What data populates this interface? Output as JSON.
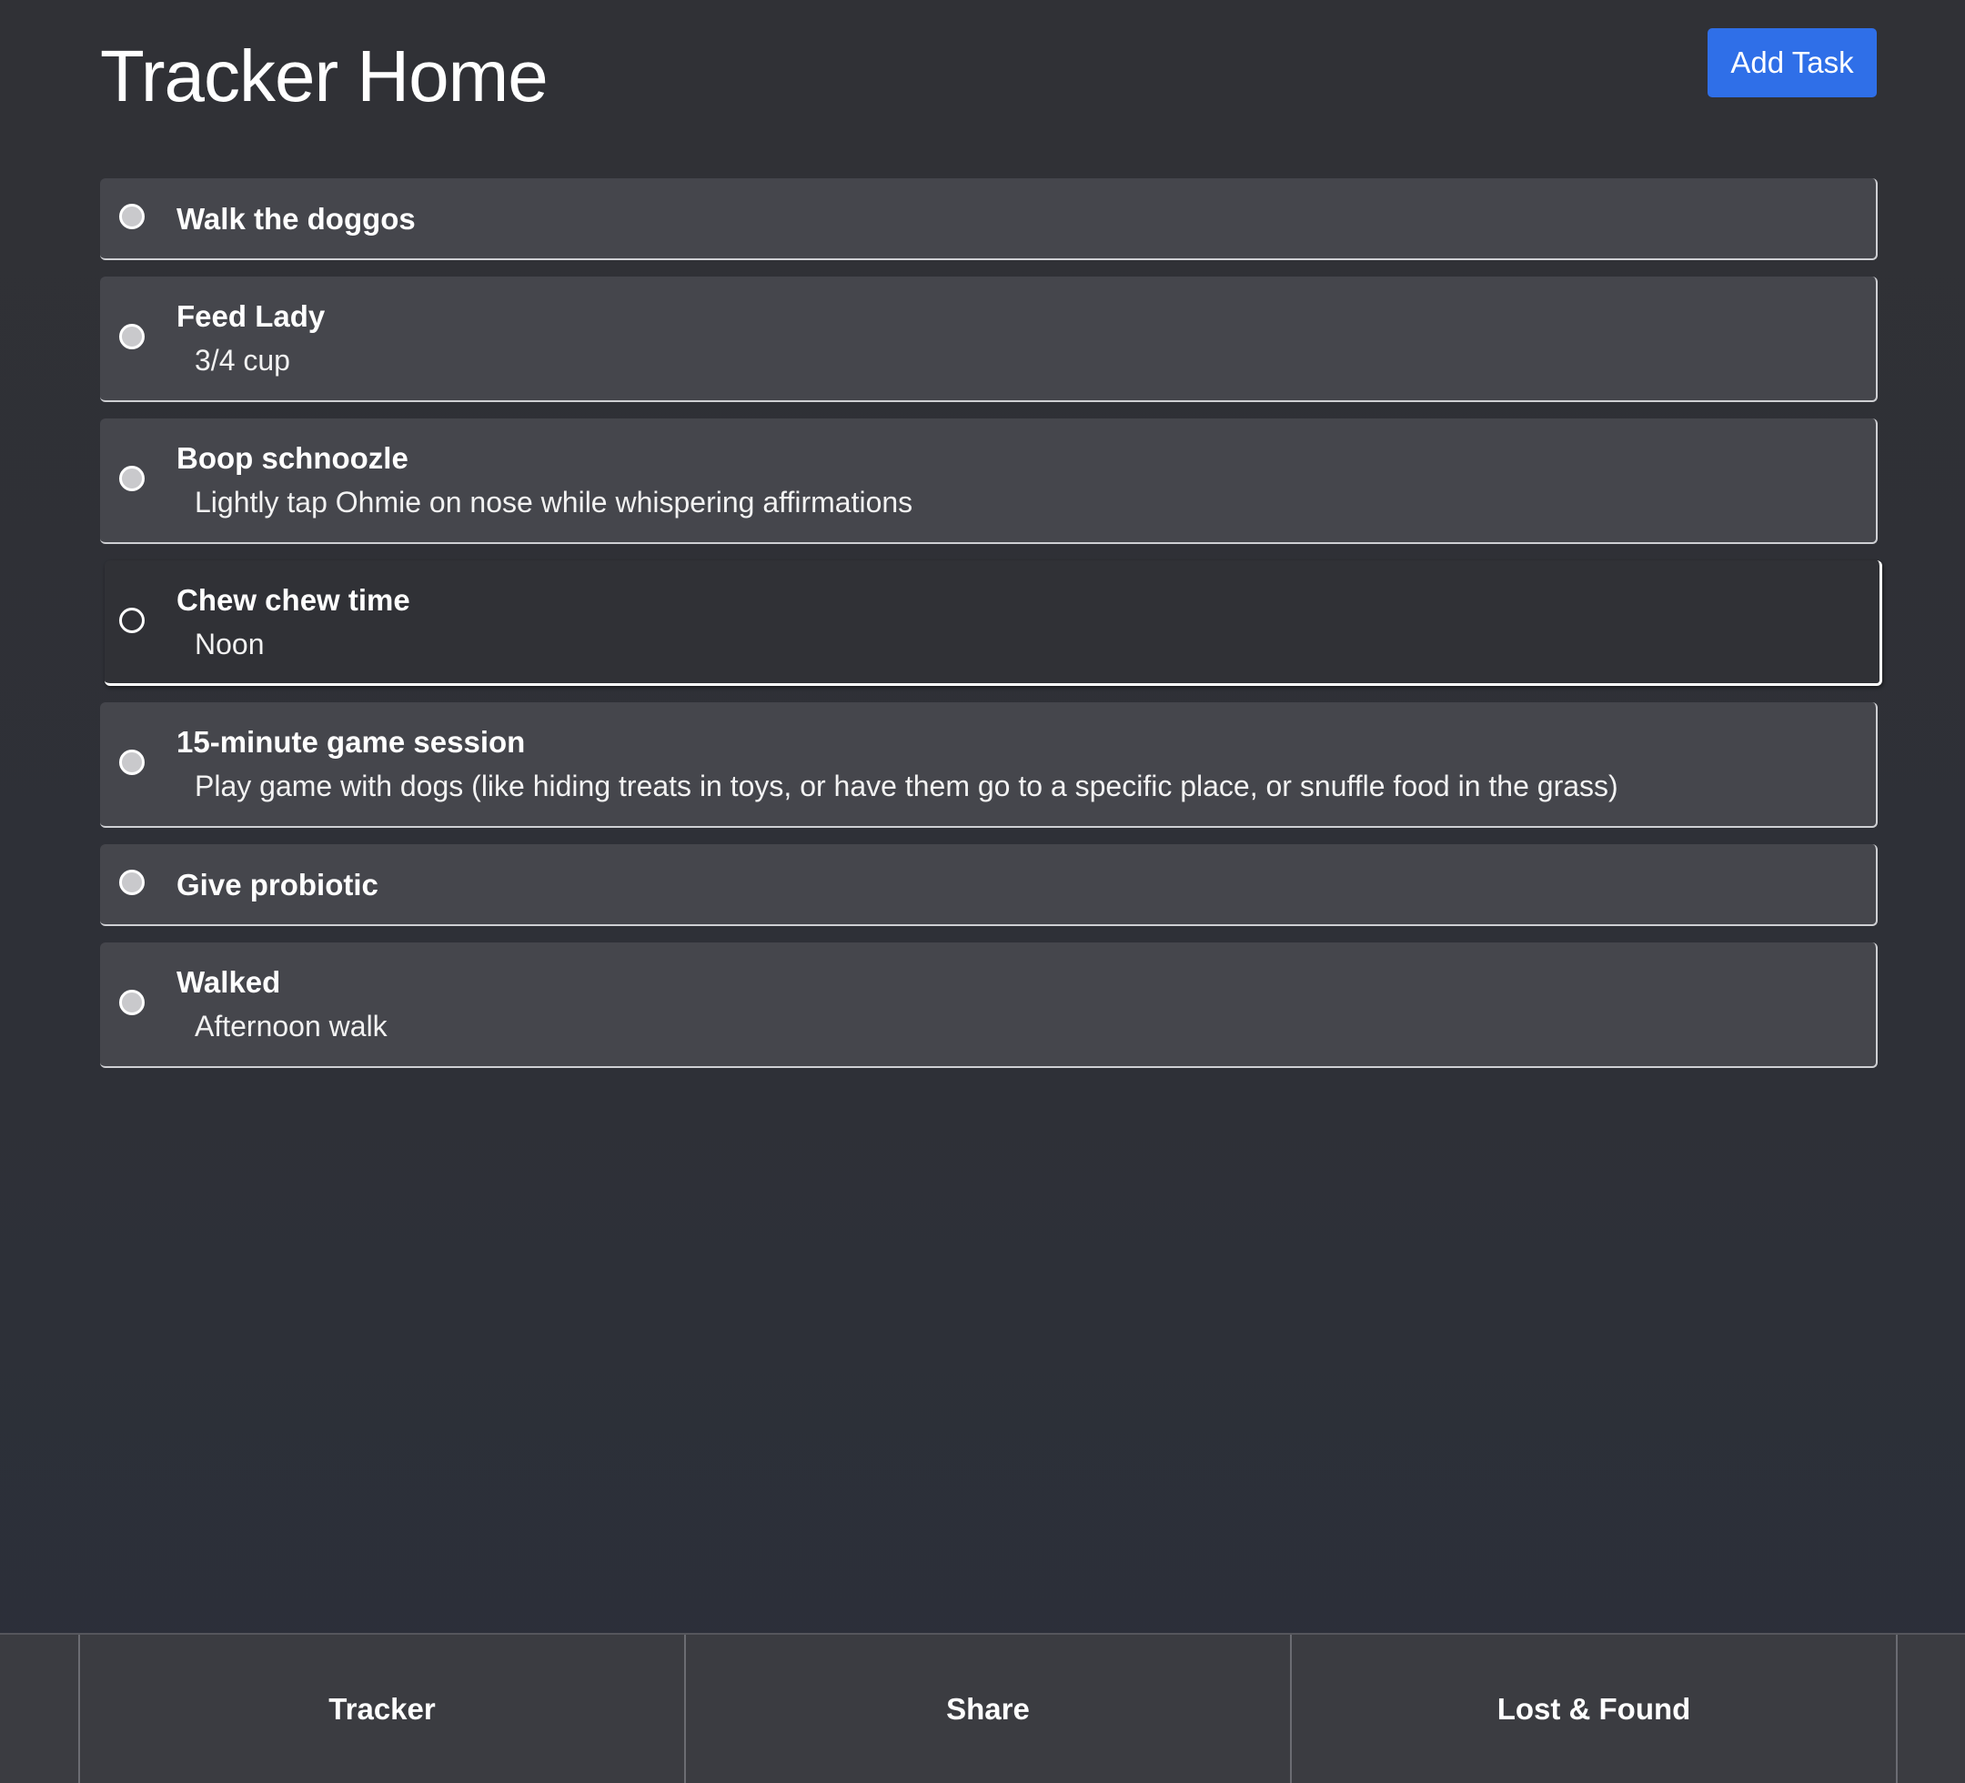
{
  "header": {
    "title": "Tracker Home",
    "add_task_label": "Add Task"
  },
  "tasks": [
    {
      "title": "Walk the doggos",
      "subtitle": "",
      "completed": false,
      "selected": false
    },
    {
      "title": "Feed Lady",
      "subtitle": "3/4 cup",
      "completed": false,
      "selected": false
    },
    {
      "title": "Boop schnoozle",
      "subtitle": "Lightly tap Ohmie on nose while whispering affirmations",
      "completed": false,
      "selected": false
    },
    {
      "title": "Chew chew time",
      "subtitle": "Noon",
      "completed": false,
      "selected": true
    },
    {
      "title": "15-minute game session",
      "subtitle": "Play game with dogs (like hiding treats in toys, or have them go to a specific place, or snuffle food in the grass)",
      "completed": false,
      "selected": false
    },
    {
      "title": "Give probiotic",
      "subtitle": "",
      "completed": false,
      "selected": false
    },
    {
      "title": "Walked",
      "subtitle": "Afternoon walk",
      "completed": false,
      "selected": false
    }
  ],
  "nav": {
    "tabs": [
      {
        "label": "Tracker"
      },
      {
        "label": "Share"
      },
      {
        "label": "Lost & Found"
      }
    ]
  },
  "colors": {
    "accent": "#2f6fe8",
    "background": "#303136",
    "card": "#45464c"
  }
}
